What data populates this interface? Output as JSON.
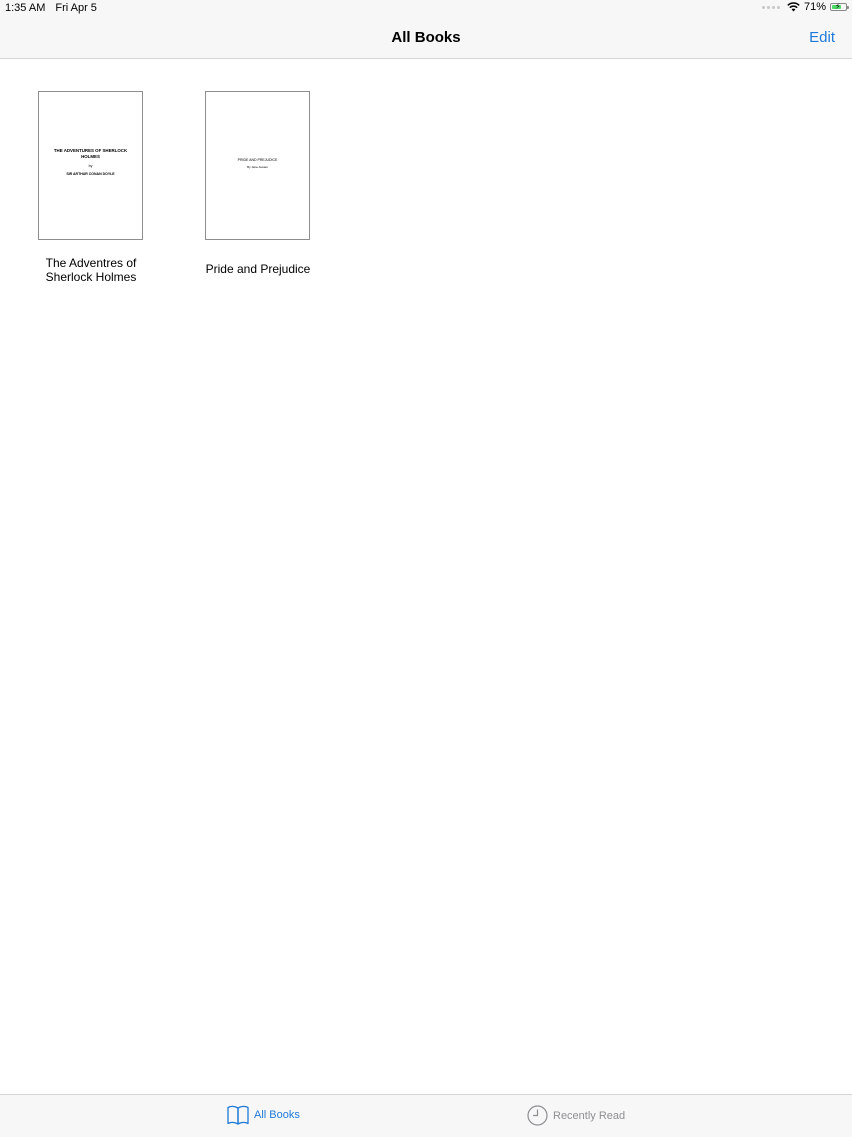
{
  "status_bar": {
    "time": "1:35 AM",
    "date": "Fri Apr 5",
    "battery_percent": "71%",
    "battery_level": 0.71
  },
  "nav": {
    "title": "All Books",
    "edit_label": "Edit"
  },
  "books": [
    {
      "title": "The Adventres of Sherlock Holmes",
      "cover_title": "THE ADVENTURES OF SHERLOCK HOLMES",
      "cover_by": "by",
      "cover_author": "SIR ARTHUR CONAN DOYLE"
    },
    {
      "title": "Pride and Prejudice",
      "cover_title": "PRIDE AND PREJUDICE",
      "cover_author": "By Jane Austen"
    }
  ],
  "tabs": [
    {
      "label": "All Books",
      "icon": "open-book-icon",
      "active": true
    },
    {
      "label": "Recently Read",
      "icon": "clock-icon",
      "active": false
    }
  ],
  "colors": {
    "accent": "#1e7ad8",
    "inactive": "#8e8e93",
    "battery": "#4cd964"
  }
}
